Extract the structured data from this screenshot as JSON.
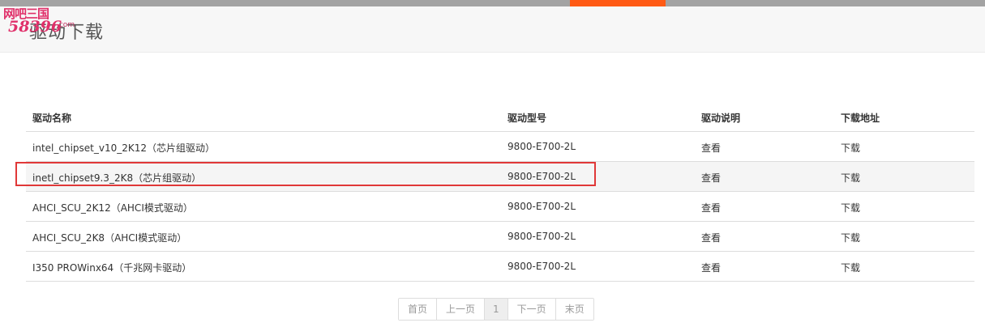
{
  "watermark": {
    "line1": "网吧三国",
    "line2": "58396",
    "domain": ".com"
  },
  "header": {
    "title": "驱动下载"
  },
  "colors": {
    "accent": "#ff5a14",
    "highlight_border": "#e03838"
  },
  "table": {
    "columns": [
      "驱动名称",
      "驱动型号",
      "驱动说明",
      "下载地址"
    ],
    "rows": [
      {
        "name": "intel_chipset_v10_2K12（芯片组驱动）",
        "model": "9800-E700-2L",
        "desc": "查看",
        "download": "下载"
      },
      {
        "name": "inetl_chipset9.3_2K8（芯片组驱动）",
        "model": "9800-E700-2L",
        "desc": "查看",
        "download": "下载"
      },
      {
        "name": "AHCI_SCU_2K12（AHCI模式驱动）",
        "model": "9800-E700-2L",
        "desc": "查看",
        "download": "下载"
      },
      {
        "name": "AHCI_SCU_2K8（AHCI模式驱动）",
        "model": "9800-E700-2L",
        "desc": "查看",
        "download": "下载"
      },
      {
        "name": "I350 PROWinx64（千兆网卡驱动）",
        "model": "9800-E700-2L",
        "desc": "查看",
        "download": "下载"
      }
    ],
    "highlighted_row": 1
  },
  "pagination": {
    "first": "首页",
    "prev": "上一页",
    "current": "1",
    "next": "下一页",
    "last": "末页"
  }
}
